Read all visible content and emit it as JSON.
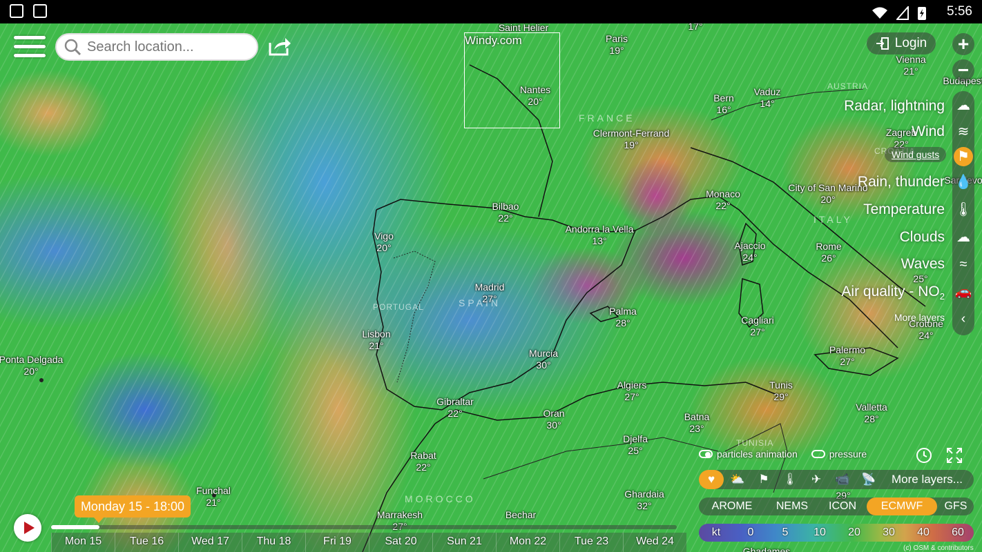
{
  "status_bar": {
    "time": "5:56"
  },
  "search": {
    "placeholder": "Search location..."
  },
  "minimap": {
    "title": "Windy.com"
  },
  "login": {
    "label": "Login"
  },
  "zoom": {
    "in": "+",
    "out": "−"
  },
  "layers": {
    "radar": "Radar, lightning",
    "wind": "Wind",
    "gusts": "Wind gusts",
    "rain": "Rain, thunder",
    "temperature": "Temperature",
    "clouds": "Clouds",
    "waves": "Waves",
    "air_quality": "Air quality - NO",
    "air_quality_sub": "2",
    "more": "More layers"
  },
  "map": {
    "cities": [
      {
        "name": "Saint Helier",
        "temp": ""
      },
      {
        "name": "Paris",
        "temp": "19°"
      },
      {
        "name": "Nantes",
        "temp": "20°"
      },
      {
        "name": "Vienna",
        "temp": "21°"
      },
      {
        "name": "Budapest",
        "temp": ""
      },
      {
        "name": "Bern",
        "temp": "16°"
      },
      {
        "name": "Vaduz",
        "temp": "14°"
      },
      {
        "name": "Zagreb",
        "temp": "22°"
      },
      {
        "name": "Clermont-Ferrand",
        "temp": "19°"
      },
      {
        "name": "Monaco",
        "temp": "22°"
      },
      {
        "name": "City of San Marino",
        "temp": "20°"
      },
      {
        "name": "Sarajevo",
        "temp": ""
      },
      {
        "name": "Bilbao",
        "temp": "22°"
      },
      {
        "name": "Andorra la Vella",
        "temp": "13°"
      },
      {
        "name": "Vigo",
        "temp": "20°"
      },
      {
        "name": "Ajaccio",
        "temp": "24°"
      },
      {
        "name": "Rome",
        "temp": "26°"
      },
      {
        "name": "Madrid",
        "temp": "27°"
      },
      {
        "name": "Palma",
        "temp": "28°"
      },
      {
        "name": "Lisbon",
        "temp": "21°"
      },
      {
        "name": "Cagliari",
        "temp": "27°"
      },
      {
        "name": "Crotone",
        "temp": "24°"
      },
      {
        "name": "Murcia",
        "temp": "30°"
      },
      {
        "name": "Ponta Delgada",
        "temp": "20°"
      },
      {
        "name": "Palermo",
        "temp": "27°"
      },
      {
        "name": "Algiers",
        "temp": "27°"
      },
      {
        "name": "Tunis",
        "temp": "29°"
      },
      {
        "name": "Gibraltar",
        "temp": "22°"
      },
      {
        "name": "Oran",
        "temp": "30°"
      },
      {
        "name": "Batna",
        "temp": "23°"
      },
      {
        "name": "Valletta",
        "temp": "28°"
      },
      {
        "name": "Djelfa",
        "temp": "25°"
      },
      {
        "name": "Rabat",
        "temp": "22°"
      },
      {
        "name": "Funchal",
        "temp": "21°"
      },
      {
        "name": "Ghardaia",
        "temp": "32°"
      },
      {
        "name": "Marrakesh",
        "temp": "27°"
      },
      {
        "name": "Bechar",
        "temp": ""
      },
      {
        "name": "Ghadames",
        "temp": ""
      },
      {
        "name": "",
        "temp": "17°"
      },
      {
        "name": "",
        "temp": "25°"
      },
      {
        "name": "",
        "temp": "29°"
      }
    ],
    "countries": [
      "FRANCE",
      "AUSTRIA",
      "ITALY",
      "SPAIN",
      "PORTUGAL",
      "MOROCCO",
      "TUNISIA",
      "CROATIA"
    ]
  },
  "toggles": {
    "particles": "particles animation",
    "pressure": "pressure"
  },
  "favorites": {
    "more": "More layers..."
  },
  "models": [
    "AROME",
    "NEMS",
    "ICON",
    "ECMWF",
    "GFS"
  ],
  "active_model": "ECMWF",
  "legend": {
    "unit": "kt",
    "values": [
      "0",
      "5",
      "10",
      "20",
      "30",
      "40",
      "60"
    ]
  },
  "attribution": "(c) OSM & contributors",
  "timeline": {
    "current": "Monday 15 - 18:00",
    "progress_fraction": 0.077,
    "days": [
      "Mon 15",
      "Tue 16",
      "Wed 17",
      "Thu 18",
      "Fri 19",
      "Sat 20",
      "Sun 21",
      "Mon 22",
      "Tue 23",
      "Wed 24"
    ]
  }
}
